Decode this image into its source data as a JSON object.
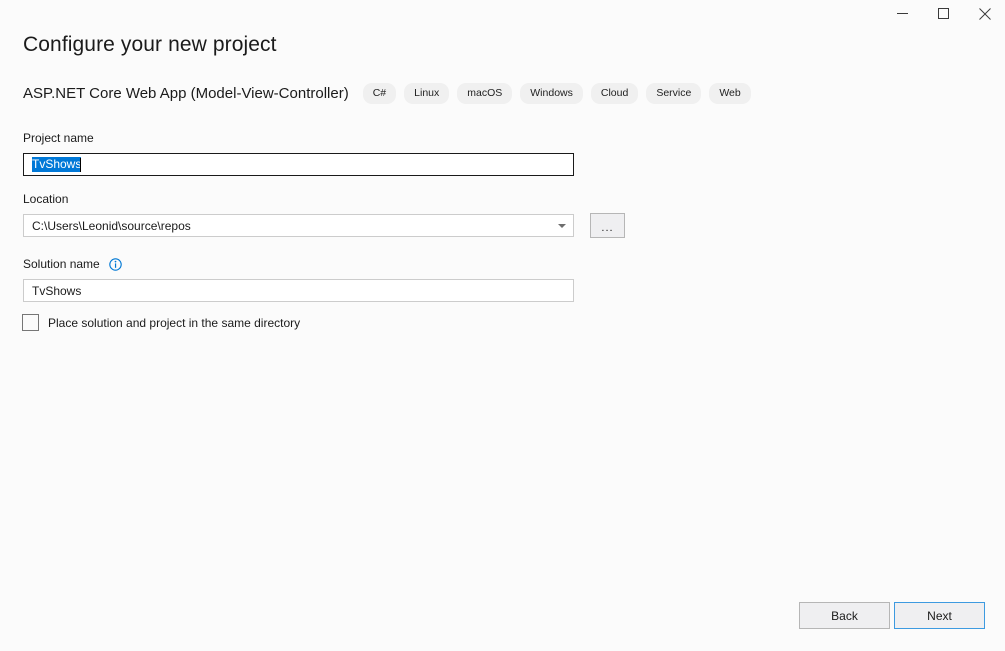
{
  "window": {
    "controls": [
      {
        "name": "minimize",
        "icon": "minimize-icon"
      },
      {
        "name": "maximize",
        "icon": "maximize-icon"
      },
      {
        "name": "close",
        "icon": "close-icon"
      }
    ]
  },
  "page": {
    "title": "Configure your new project",
    "template_name": "ASP.NET Core Web App (Model-View-Controller)",
    "tags": [
      "C#",
      "Linux",
      "macOS",
      "Windows",
      "Cloud",
      "Service",
      "Web"
    ]
  },
  "fields": {
    "project_name": {
      "label": "Project name",
      "value": "TvShows",
      "selected": true
    },
    "location": {
      "label": "Location",
      "value": "C:\\Users\\Leonid\\source\\repos",
      "browse_label": "...",
      "dropdown_icon": "chevron-down-icon"
    },
    "solution_name": {
      "label": "Solution name",
      "info_icon": "info-icon",
      "value": "TvShows"
    },
    "same_directory": {
      "label": "Place solution and project in the same directory",
      "checked": false
    }
  },
  "footer": {
    "back_label": "Back",
    "next_label": "Next"
  },
  "colors": {
    "selection_blue": "#0078d7",
    "accent_blue": "#3d9ae0",
    "info_blue": "#0078d4",
    "background": "#fbfbfb",
    "tag_background": "#f0f0f0"
  }
}
